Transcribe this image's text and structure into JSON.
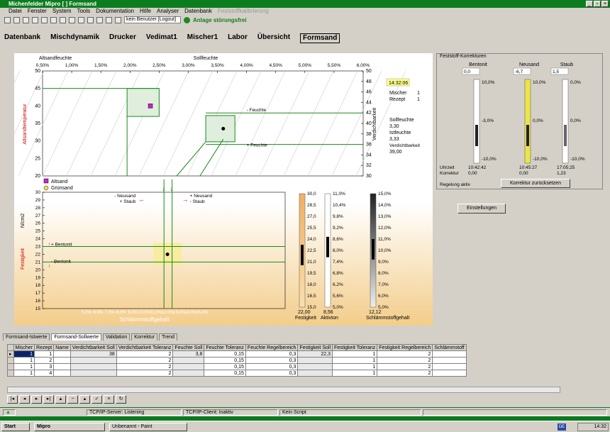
{
  "window": {
    "title": "Michenfelder Mipro [          ]     Formsand"
  },
  "menu": [
    "Datei",
    "Fenster",
    "System",
    "Tools",
    "Dokumentation",
    "Hilfe",
    "Analyser",
    "Datenbank",
    "Feststoffkalibrierung"
  ],
  "toolbar": {
    "user_field": "kein Benutzer [Logout]",
    "status_label": "Anlage störungsfrei"
  },
  "tabs": [
    "Datenbank",
    "Mischdynamik",
    "Drucker",
    "Vedimat1",
    "Mischer1",
    "Labor",
    "Übersicht",
    "Formsand"
  ],
  "chart_data": {
    "type": "scatter",
    "top_axis_label": "Altsandfeuchte",
    "top_axis_center": "Sollfeuchte",
    "x_ticks": [
      "0,50%",
      "1,00%",
      "1,50%",
      "2,00%",
      "2,50%",
      "3,00%",
      "3,50%",
      "4,00%",
      "4,50%",
      "5,00%",
      "5,50%",
      "6,00%"
    ],
    "top_y_left": {
      "label": "Altsandtemperatur",
      "range": [
        20,
        50
      ],
      "ticks": [
        20,
        25,
        30,
        35,
        40,
        45,
        50
      ]
    },
    "top_y_right": {
      "label": "Verdichtbarkeit",
      "range": [
        30,
        50
      ],
      "ticks": [
        30,
        32,
        34,
        36,
        38,
        40,
        42,
        44,
        46,
        48,
        50
      ]
    },
    "bottom_y": {
      "label": "Festigkeit",
      "unit": "N/cm2",
      "range": [
        15,
        30
      ],
      "ticks": [
        15,
        16,
        17,
        18,
        19,
        20,
        21,
        22,
        23,
        24,
        25,
        26,
        27,
        28,
        29,
        30
      ]
    },
    "bottom_x": {
      "label": "Schlämmstoffgehalt",
      "ticks": [
        "5,0%",
        "6,0%",
        "7,0%",
        "8,0%",
        "9,0%",
        "10,0%",
        "11,0%",
        "12,0%",
        "13,0%",
        "14,0%",
        "15,0%"
      ]
    },
    "legend": [
      "Altsand",
      "Grünsand"
    ],
    "annotations": [
      "- Feuchte",
      "+ Feuchte",
      "- Neusand",
      "+ Staub",
      "+ Neusand",
      "- Staub",
      "+ Bentonit",
      "- Bentonit"
    ],
    "markers": [
      {
        "series": "Altsand",
        "x": 2.35,
        "y": 40
      },
      {
        "series": "Grünsand",
        "x": 3.6,
        "y": 39
      }
    ],
    "festigkeit_marker": {
      "x": 12.0,
      "y": 22
    }
  },
  "scales": {
    "festigkeit": {
      "ticks": [
        "30,0",
        "28,5",
        "27,0",
        "25,5",
        "24,0",
        "22,5",
        "21,0",
        "19,5",
        "18,0",
        "16,5",
        "15,0"
      ],
      "value": "22,00",
      "label": "Festigkeit"
    },
    "aktivton": {
      "ticks": [
        "11,0%",
        "10,4%",
        "9,8%",
        "9,2%",
        "8,6%",
        "8,0%",
        "7,4%",
        "6,8%",
        "6,2%",
        "5,6%",
        "5,0%"
      ],
      "value": "8,56",
      "label": "Aktivton"
    },
    "schlaemm": {
      "ticks": [
        "15,0%",
        "14,0%",
        "13,0%",
        "12,0%",
        "11,0%",
        "10,0%",
        "9,0%",
        "8,0%",
        "7,0%",
        "6,0%",
        "5,0%"
      ],
      "value": "12,12",
      "label": "Schlämmstoffgehalt"
    }
  },
  "info": {
    "time": "14:32:06",
    "mischer_label": "Mischer",
    "mischer": "1",
    "rezept_label": "Rezept",
    "rezept": "1",
    "sollfeuchte_label": "Sollfeuchte",
    "sollfeuchte": "3,30",
    "istfeuchte_label": "Istfeuchte",
    "istfeuchte": "3,33",
    "verdicht_label": "Verdichtbarkeit",
    "verdicht": "39,00"
  },
  "korrektur": {
    "title": "Feststoff-Korrekturen",
    "cols": [
      {
        "name": "Bentonit",
        "value": "0,0",
        "top": "10,0%",
        "mid": "-3,0%",
        "bot": "-10,0%",
        "time": "10:42:42",
        "korr": "0,00"
      },
      {
        "name": "Neusand",
        "value": "-6,7",
        "top": "10,0%",
        "mid": "0,0%",
        "bot": "-10,0%",
        "time": "10:45:27",
        "korr": "0,00"
      },
      {
        "name": "Staub",
        "value": "1,5",
        "top": "0,0%",
        "mid": "0,0%",
        "bot": "-10,0%",
        "time": "17:05:25",
        "korr": "1,23"
      }
    ],
    "uhrzeit": "Uhrzeit",
    "korrektur": "Korrektur",
    "regelung": "Regelung aktiv",
    "reset_btn": "Korrektur zurücksetzen"
  },
  "einstellungen_btn": "Einstellungen",
  "grid_tabs": [
    "Formsand-Istwerte",
    "Formsand-Sollwerte",
    "Validation",
    "Korrektur",
    "Trend"
  ],
  "grid": {
    "headers": [
      "Mischer",
      "Rezept",
      "Name",
      "Verdichtbarkeit Soll",
      "Verdichtbarkeit Toleranz",
      "Feuchte Soll",
      "Feuchte Toleranz",
      "Feuchte Regelbereich",
      "Festigkeit Soll",
      "Festigkeit Toleranz",
      "Festigkeit Regelbereich",
      "Schlämmstoff"
    ],
    "rows": [
      [
        "1",
        "1",
        "",
        "38",
        "2",
        "3,8",
        "0,15",
        "0,3",
        "22,3",
        "1",
        "2",
        ""
      ],
      [
        "1",
        "2",
        "",
        "",
        "2",
        "",
        "0,15",
        "0,3",
        "",
        "1",
        "2",
        ""
      ],
      [
        "1",
        "3",
        "",
        "",
        "2",
        "",
        "0,15",
        "0,3",
        "",
        "1",
        "2",
        ""
      ],
      [
        "1",
        "4",
        "",
        "",
        "2",
        "",
        "0,15",
        "0,3",
        "",
        "1",
        "2",
        ""
      ]
    ]
  },
  "status": {
    "server": "TCP/IP-Server: Listening",
    "client": "TCP/IP-Client: Inaktiv",
    "script": "Kein Script"
  },
  "taskbar": {
    "start": "Start",
    "mipro": "Mipro",
    "paint": "Unbenannt - Paint",
    "lang": "DE",
    "clock": "14:32"
  }
}
